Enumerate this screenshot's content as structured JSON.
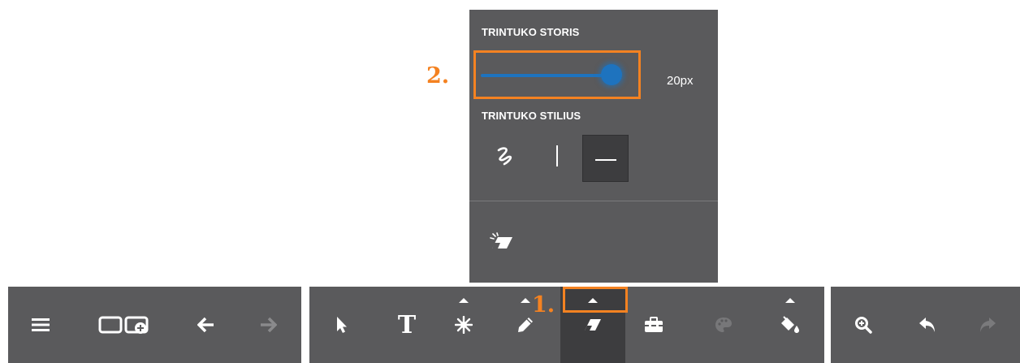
{
  "toolbar": {
    "left": [
      {
        "icon": "hamburger-menu-icon"
      },
      {
        "icon": "add-page-icon"
      },
      {
        "icon": "arrow-left-icon"
      },
      {
        "icon": "arrow-right-icon",
        "disabled": true
      }
    ],
    "tools": [
      {
        "icon": "pointer-icon"
      },
      {
        "icon": "text-tool-icon",
        "label": "T"
      },
      {
        "icon": "spark-icon",
        "has_menu": true
      },
      {
        "icon": "pencil-icon",
        "has_menu": true
      },
      {
        "icon": "eraser-icon",
        "has_menu": true,
        "active": true
      },
      {
        "icon": "toolbox-icon"
      },
      {
        "icon": "palette-icon",
        "disabled": true
      },
      {
        "icon": "paint-bucket-icon",
        "has_menu": true
      }
    ],
    "right": [
      {
        "icon": "zoom-in-icon"
      },
      {
        "icon": "undo-icon"
      },
      {
        "icon": "redo-icon",
        "disabled": true
      }
    ]
  },
  "eraser_panel": {
    "size_title": "TRINTUKO STORIS",
    "size_value": "20px",
    "size_fraction": 1.0,
    "style_title": "TRINTUKO STILIUS",
    "styles": [
      {
        "icon": "freehand-stroke-icon"
      },
      {
        "icon": "vertical-line-icon"
      },
      {
        "icon": "horizontal-line-icon",
        "selected": true
      }
    ],
    "clear_icon": "clear-all-icon"
  },
  "annotations": {
    "step1": "1.",
    "step2": "2."
  },
  "colors": {
    "toolbar_bg": "#5a5a5c",
    "active_bg": "#3d3d3f",
    "accent_blue": "#1e73be",
    "callout_orange": "#f48221"
  }
}
